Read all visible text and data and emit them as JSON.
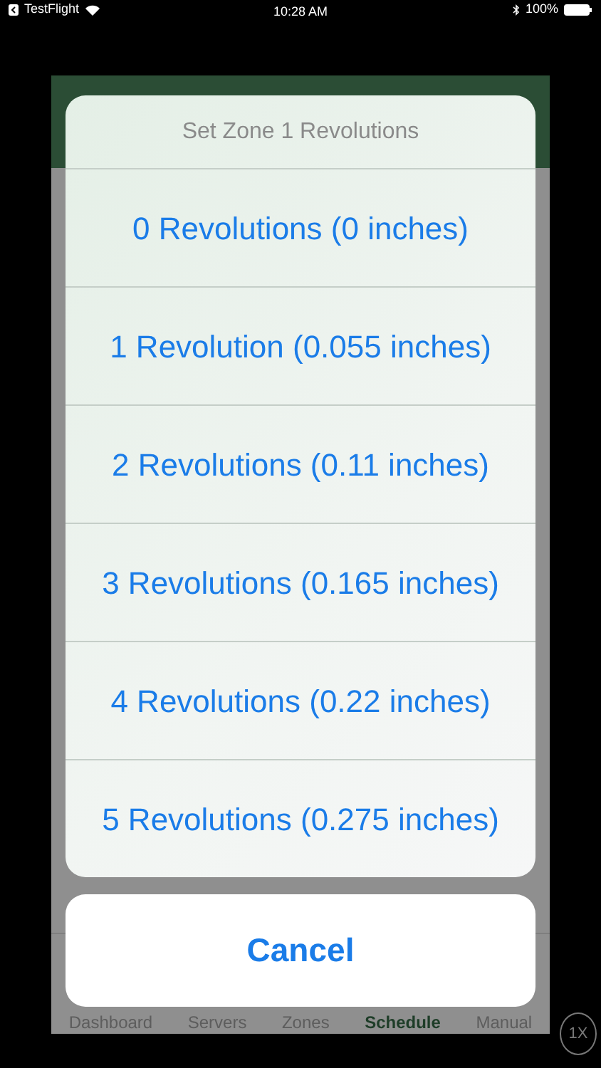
{
  "status_bar": {
    "back_app": "TestFlight",
    "time": "10:28 AM",
    "battery": "100%"
  },
  "action_sheet": {
    "title": "Set Zone 1 Revolutions",
    "options": [
      {
        "label": "0 Revolutions (0 inches)"
      },
      {
        "label": "1 Revolution (0.055 inches)"
      },
      {
        "label": "2 Revolutions (0.11 inches)"
      },
      {
        "label": "3 Revolutions (0.165 inches)"
      },
      {
        "label": "4 Revolutions (0.22 inches)"
      },
      {
        "label": "5 Revolutions (0.275 inches)"
      }
    ],
    "cancel": "Cancel"
  },
  "tab_bar": [
    {
      "label": "Dashboard",
      "selected": false
    },
    {
      "label": "Servers",
      "selected": false
    },
    {
      "label": "Zones",
      "selected": false
    },
    {
      "label": "Schedule",
      "selected": true
    },
    {
      "label": "Manual",
      "selected": false
    }
  ],
  "zoom_button": "1X"
}
